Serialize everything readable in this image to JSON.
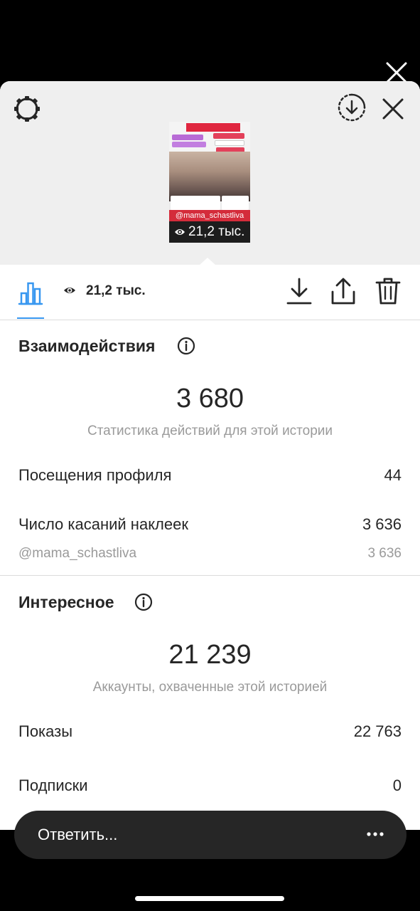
{
  "story": {
    "thumbnail_handle": "@mama_schastliva",
    "thumbnail_views": "21,2 тыс."
  },
  "tabs": {
    "views": "21,2 тыс."
  },
  "interactions": {
    "title": "Взаимодействия",
    "total": "3 680",
    "caption": "Статистика действий для этой истории",
    "rows": [
      {
        "label": "Посещения профиля",
        "value": "44"
      },
      {
        "label": "Число касаний наклеек",
        "value": "3 636"
      }
    ],
    "sub_row": {
      "label": "@mama_schastliva",
      "value": "3 636"
    }
  },
  "discovery": {
    "title": "Интересное",
    "total": "21 239",
    "caption": "Аккаунты, охваченные этой историей",
    "rows": [
      {
        "label": "Показы",
        "value": "22 763"
      },
      {
        "label": "Подписки",
        "value": "0"
      }
    ]
  },
  "reply": {
    "placeholder": "Ответить..."
  },
  "colors": {
    "accent": "#3897f0",
    "handle_bg": "#d42c3b",
    "reply_bg": "#262626"
  },
  "icons": [
    "close-icon",
    "gear-icon",
    "download-circle-icon",
    "bar-chart-icon",
    "eye-icon",
    "download-icon",
    "share-icon",
    "trash-icon",
    "info-icon",
    "more-dots-icon"
  ]
}
